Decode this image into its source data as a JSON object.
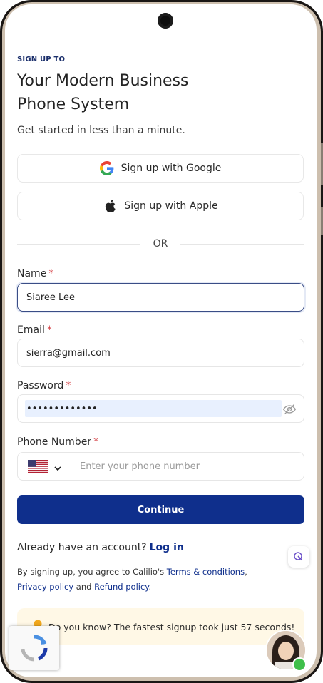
{
  "header": {
    "eyebrow": "SIGN UP TO",
    "title_line1": "Your Modern Business",
    "title_line2": "Phone System",
    "subtitle": "Get started in less than a minute."
  },
  "social": {
    "google_label": "Sign up with Google",
    "apple_label": "Sign up with Apple",
    "google_icon": "google-icon",
    "apple_icon": "apple-icon"
  },
  "divider": {
    "text": "OR"
  },
  "form": {
    "name": {
      "label": "Name",
      "required_mark": "*",
      "value": "Siaree Lee"
    },
    "email": {
      "label": "Email",
      "required_mark": "*",
      "value": "sierra@gmail.com"
    },
    "password": {
      "label": "Password",
      "required_mark": "*",
      "value": "•••••••••••••",
      "toggle_icon": "eye-off-icon"
    },
    "phone": {
      "label": "Phone Number",
      "required_mark": "*",
      "country_flag": "us-flag-icon",
      "placeholder": "Enter your phone number"
    }
  },
  "actions": {
    "continue_label": "Continue"
  },
  "login": {
    "prompt": "Already have an account?",
    "link": "Log in"
  },
  "terms": {
    "prefix": "By signing up, you agree to Calilio's ",
    "terms_link": "Terms & conditions",
    "sep": ",",
    "privacy_link": "Privacy policy",
    "and": " and ",
    "refund_link": "Refund policy",
    "end": "."
  },
  "fact": {
    "text": "Do you know? The fastest signup took just 57 seconds!",
    "icon": "lightbulb-icon"
  },
  "colors": {
    "primary": "#0f2f8c",
    "required": "#d6454a",
    "fact_bg": "#fff8e6",
    "autofill": "#e8f0fe"
  }
}
